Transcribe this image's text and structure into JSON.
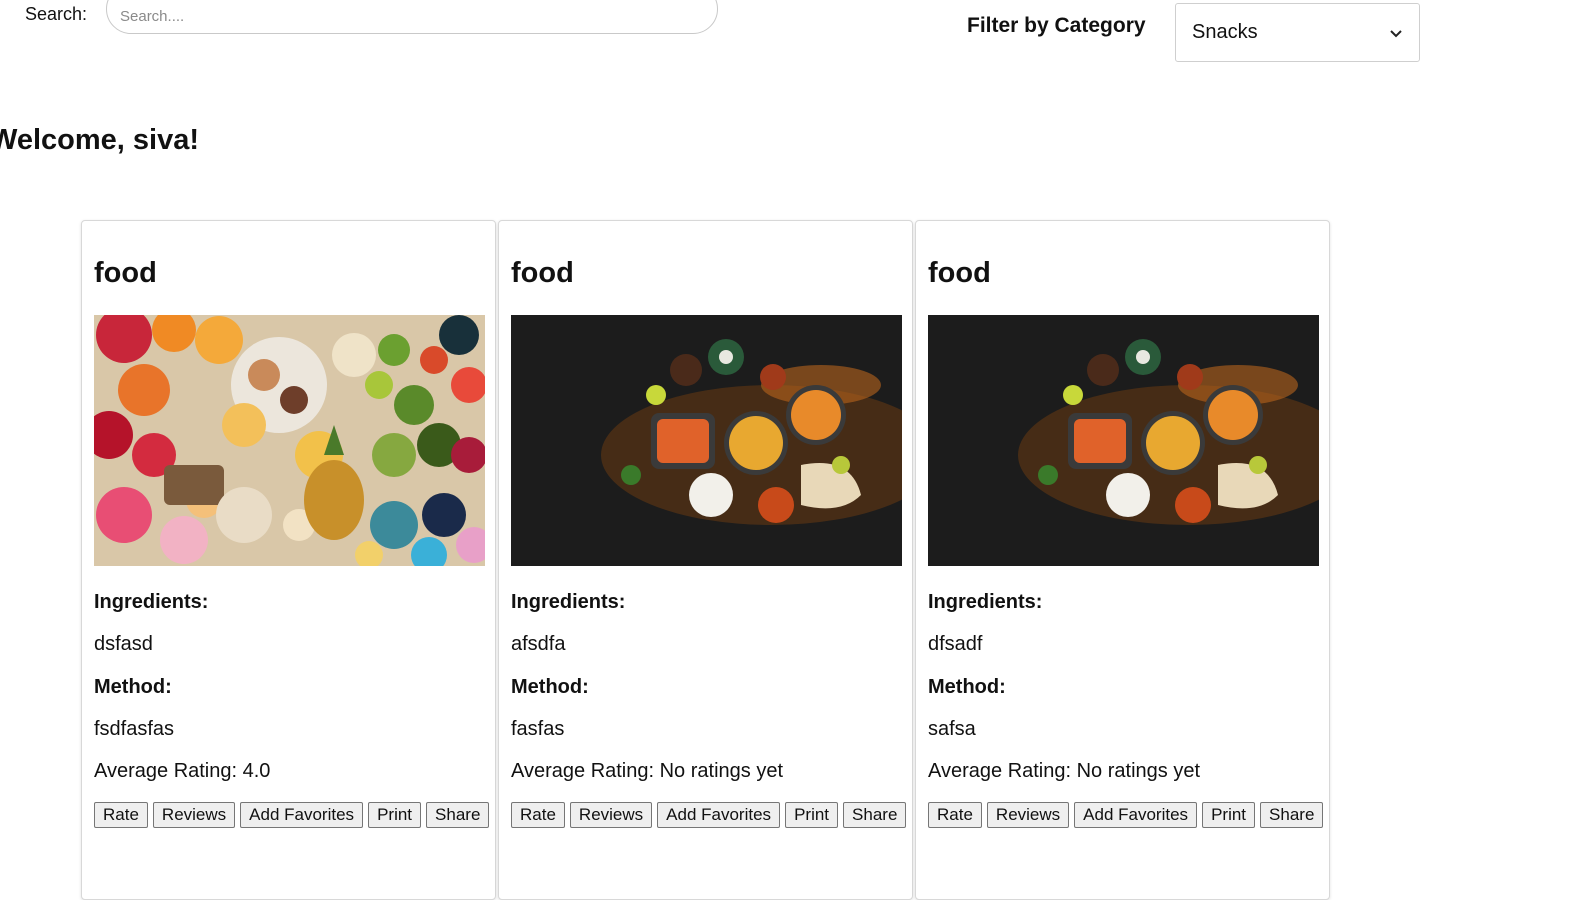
{
  "search": {
    "label": "Search:",
    "placeholder": "Search...."
  },
  "filter": {
    "label": "Filter by Category",
    "selected": "Snacks"
  },
  "welcome": "Welcome, siva!",
  "recipes": [
    {
      "title": "food",
      "image": "colorful assorted fruits, donuts and snacks flat lay",
      "ingredients_label": "Ingredients:",
      "ingredients": "dsfasd",
      "method_label": "Method:",
      "method": "fsdfasfas",
      "rating": "Average Rating: 4.0",
      "buttons": [
        "Rate",
        "Reviews",
        "Add Favorites",
        "Print",
        "Share"
      ]
    },
    {
      "title": "food",
      "image": "Indian dishes on dark background with spices",
      "ingredients_label": "Ingredients:",
      "ingredients": "afsdfa",
      "method_label": "Method:",
      "method": "fasfas",
      "rating": "Average Rating: No ratings yet",
      "buttons": [
        "Rate",
        "Reviews",
        "Add Favorites",
        "Print",
        "Share"
      ]
    },
    {
      "title": "food",
      "image": "Indian dishes on dark background with spices",
      "ingredients_label": "Ingredients:",
      "ingredients": "dfsadf",
      "method_label": "Method:",
      "method": "safsa",
      "rating": "Average Rating: No ratings yet",
      "buttons": [
        "Rate",
        "Reviews",
        "Add Favorites",
        "Print",
        "Share"
      ]
    }
  ]
}
